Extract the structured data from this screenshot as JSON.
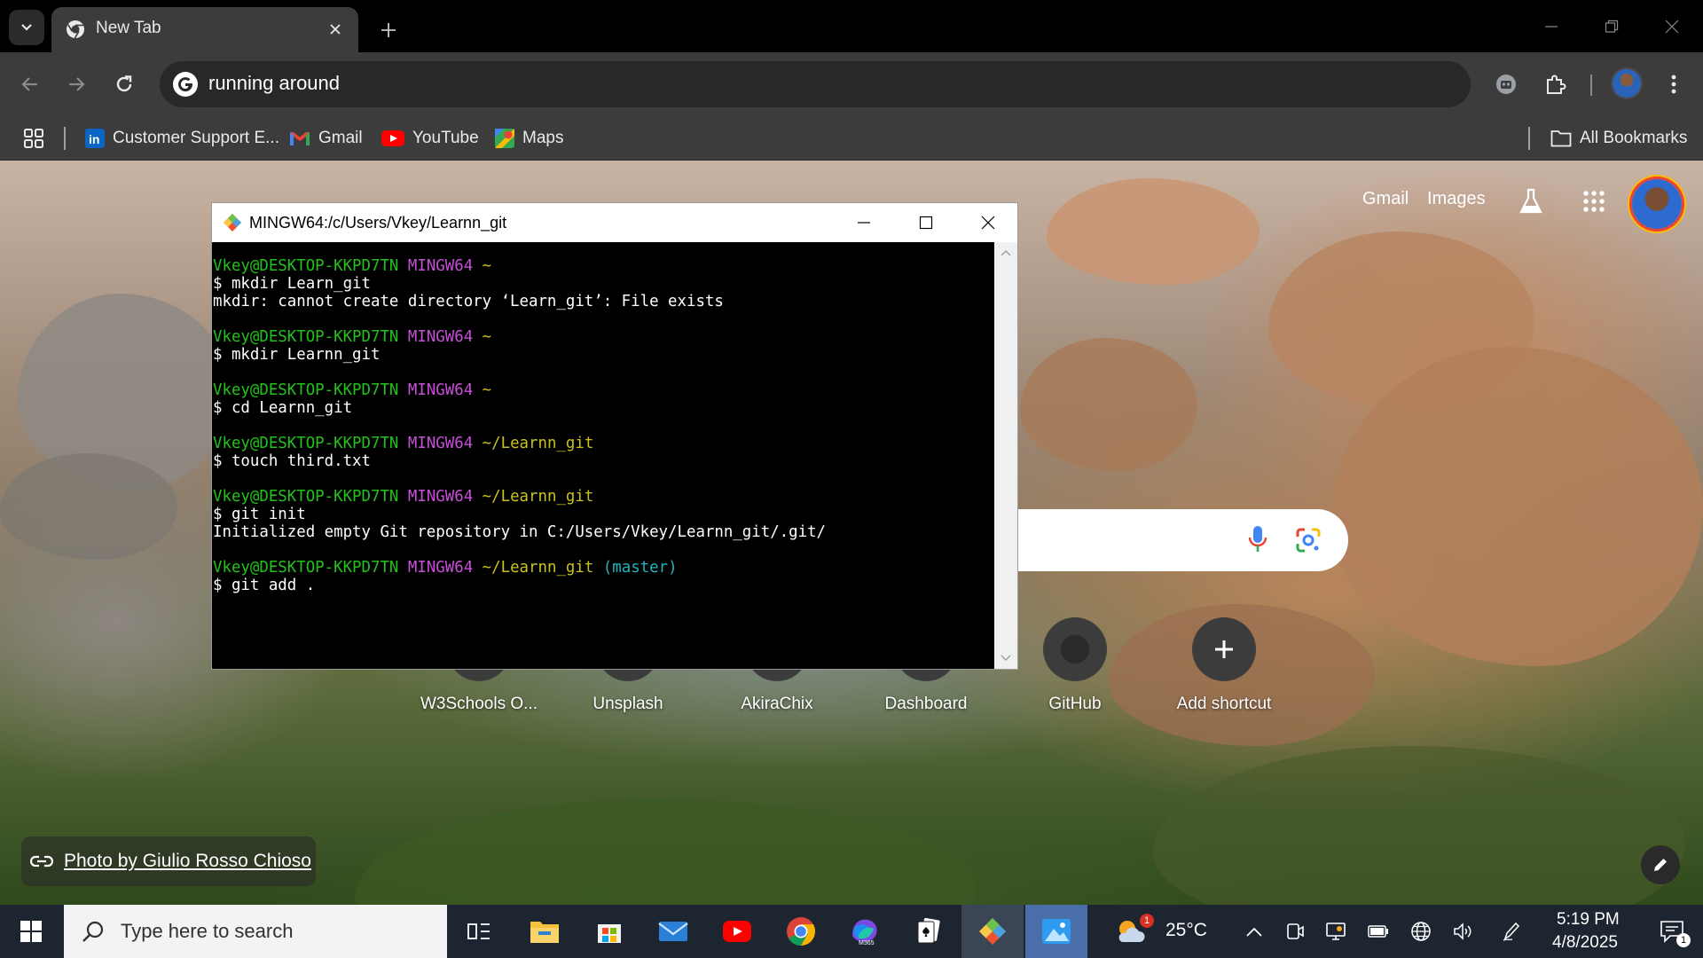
{
  "browser": {
    "tab": {
      "title": "New Tab"
    },
    "omnibox": {
      "value": "running around"
    },
    "bookmarks": [
      {
        "label": "Customer Support E...",
        "icon": "linkedin-icon"
      },
      {
        "label": "Gmail",
        "icon": "gmail-icon"
      },
      {
        "label": "YouTube",
        "icon": "youtube-icon"
      },
      {
        "label": "Maps",
        "icon": "maps-icon"
      }
    ],
    "all_bookmarks_label": "All Bookmarks"
  },
  "ntp": {
    "links": {
      "gmail": "Gmail",
      "images": "Images"
    },
    "shortcuts": [
      {
        "label": "W3Schools O..."
      },
      {
        "label": "Unsplash"
      },
      {
        "label": "AkiraChix"
      },
      {
        "label": "Dashboard"
      },
      {
        "label": "GitHub"
      },
      {
        "label": "Add shortcut"
      }
    ],
    "photo_credit": "Photo by Giulio Rosso Chioso"
  },
  "terminal": {
    "title": "MINGW64:/c/Users/Vkey/Learnn_git",
    "lines": [
      {
        "user": "Vkey@DESKTOP-KKPD7TN",
        "env": "MINGW64",
        "path": "~",
        "branch": ""
      },
      {
        "cmd": "$ mkdir Learn_git"
      },
      {
        "out": "mkdir: cannot create directory ‘Learn_git’: File exists"
      },
      {
        "blank": ""
      },
      {
        "user": "Vkey@DESKTOP-KKPD7TN",
        "env": "MINGW64",
        "path": "~",
        "branch": ""
      },
      {
        "cmd": "$ mkdir Learnn_git"
      },
      {
        "blank": ""
      },
      {
        "user": "Vkey@DESKTOP-KKPD7TN",
        "env": "MINGW64",
        "path": "~",
        "branch": ""
      },
      {
        "cmd": "$ cd Learnn_git"
      },
      {
        "blank": ""
      },
      {
        "user": "Vkey@DESKTOP-KKPD7TN",
        "env": "MINGW64",
        "path": "~/Learnn_git",
        "branch": ""
      },
      {
        "cmd": "$ touch third.txt"
      },
      {
        "blank": ""
      },
      {
        "user": "Vkey@DESKTOP-KKPD7TN",
        "env": "MINGW64",
        "path": "~/Learnn_git",
        "branch": ""
      },
      {
        "cmd": "$ git init"
      },
      {
        "out": "Initialized empty Git repository in C:/Users/Vkey/Learnn_git/.git/"
      },
      {
        "blank": ""
      },
      {
        "user": "Vkey@DESKTOP-KKPD7TN",
        "env": "MINGW64",
        "path": "~/Learnn_git",
        "branch": "(master)"
      },
      {
        "cmd": "$ git add ."
      }
    ]
  },
  "taskbar": {
    "search_placeholder": "Type here to search",
    "weather": "25°C",
    "weather_badge": "1",
    "time": "5:19 PM",
    "date": "4/8/2025",
    "notification_count": "1"
  },
  "colors": {
    "prompt_user": "#22c21a",
    "prompt_env": "#c74ed8",
    "prompt_path": "#c9c21e",
    "prompt_branch": "#21b4bd"
  }
}
